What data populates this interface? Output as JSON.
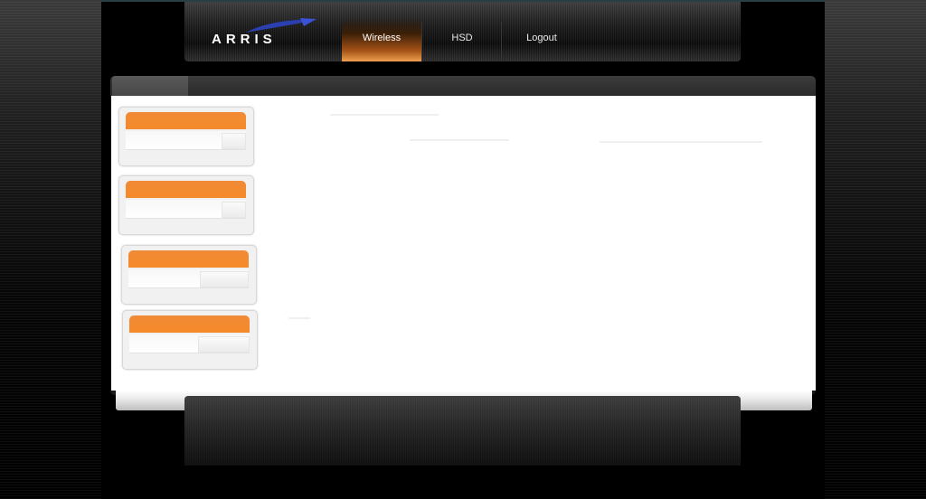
{
  "brand": {
    "logo_text": "ARRIS"
  },
  "nav": {
    "items": [
      {
        "label": "Wireless",
        "active": true
      },
      {
        "label": "HSD",
        "active": false
      },
      {
        "label": "Logout",
        "active": false
      }
    ]
  },
  "colors": {
    "accent": "#f58a2a",
    "page_background": "#000000",
    "panel_content": "#ffffff"
  },
  "icons": {
    "logo_mark": "arris-swoosh-icon"
  }
}
